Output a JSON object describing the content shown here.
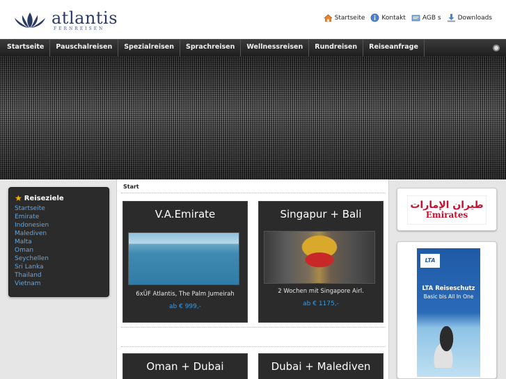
{
  "header": {
    "brand": "atlantis",
    "brand_sub": "FERNREISEN",
    "toplinks": [
      {
        "label": "Startseite",
        "icon": "home-icon"
      },
      {
        "label": "Kontakt",
        "icon": "info-icon"
      },
      {
        "label": "AGB s",
        "icon": "document-icon"
      },
      {
        "label": "Downloads",
        "icon": "download-icon"
      }
    ]
  },
  "nav": {
    "items": [
      "Startseite",
      "Pauschalreisen",
      "Spezialreisen",
      "Sprachreisen",
      "Wellnessreisen",
      "Rundreisen",
      "Reiseanfrage"
    ]
  },
  "sidebar": {
    "title": "Reiseziele",
    "items": [
      "Startseite",
      "Emirate",
      "Indonesien",
      "Malediven",
      "Malta",
      "Oman",
      "Seychellen",
      "Sri Lanka",
      "Thailand",
      "Vietnam"
    ]
  },
  "main": {
    "breadcrumb": "Start",
    "cards": [
      {
        "title": "V.A.Emirate",
        "desc": "6xÜF Atlantis, The Palm Jumeirah",
        "price": "ab € 999,-"
      },
      {
        "title": "Singapur + Bali",
        "desc": "2 Wochen mit Singapore Airl.",
        "price": "ab € 1175,-"
      },
      {
        "title": "Oman + Dubai"
      },
      {
        "title": "Dubai + Malediven"
      }
    ]
  },
  "ads": {
    "emirates": {
      "arabic": "طيران الإمارات",
      "name": "Emirates"
    },
    "lta": {
      "logo": "LTA",
      "title": "LTA Reiseschutz",
      "subtitle": "Basic bis All In One"
    }
  },
  "colors": {
    "link": "#5fa8e8",
    "price": "#3b9be0",
    "nav_bg": "#2a2a2a",
    "brand": "#2a3a66"
  }
}
